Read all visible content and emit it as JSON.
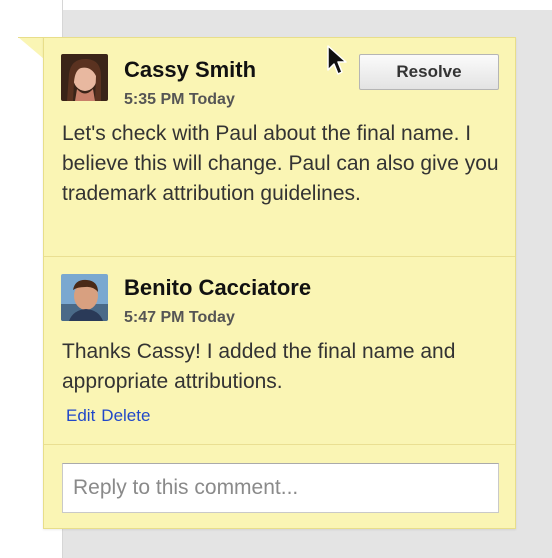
{
  "comments": [
    {
      "author": "Cassy Smith",
      "time": "5:35 PM Today",
      "text": "Let's check with Paul about the final name. I believe this will change. Paul can also give you trademark attribution guidelines."
    },
    {
      "author": "Benito Cacciatore",
      "time": "5:47 PM Today",
      "text": "Thanks Cassy! I added the final name and appropriate attributions."
    }
  ],
  "resolve_label": "Resolve",
  "actions": {
    "edit": "Edit",
    "delete": "Delete"
  },
  "reply": {
    "placeholder": "Reply to this comment...",
    "value": ""
  },
  "colors": {
    "card_bg": "#faf5b4",
    "card_border": "#e8de8a",
    "link": "#2148c9",
    "page_bg": "#e4e4e4"
  },
  "icons": [
    "avatar-cassy",
    "avatar-benito",
    "mouse-cursor-icon"
  ]
}
